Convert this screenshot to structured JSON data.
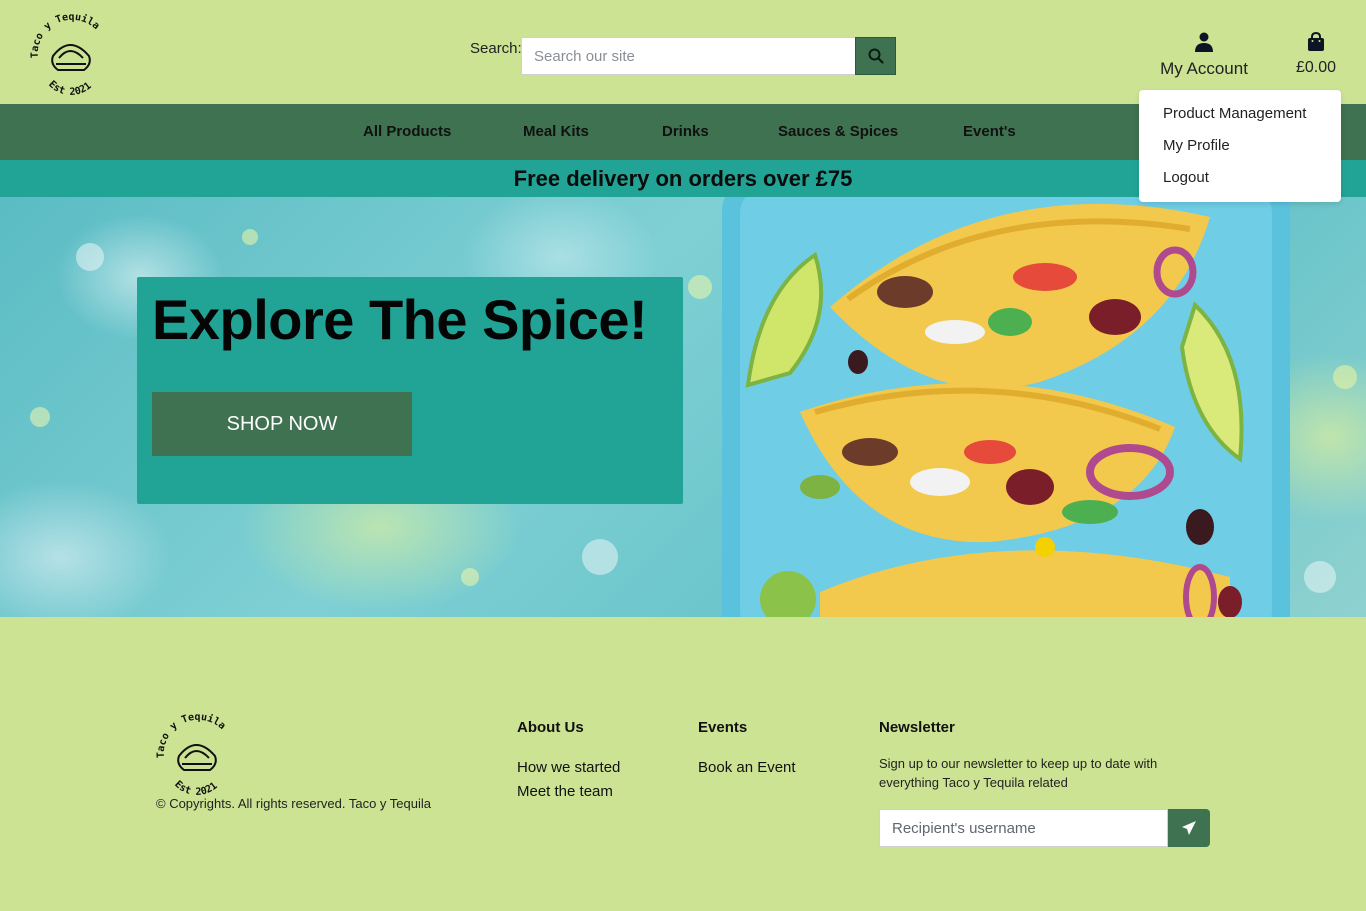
{
  "brand": {
    "logo_text_top": "Taco y Tequila",
    "logo_text_bottom": "Est 2021"
  },
  "header": {
    "search_label": "Search:",
    "search_placeholder": "Search our site",
    "search_icon": "magnifier-icon",
    "account_label": "My Account",
    "account_icon": "user-icon",
    "bag_total": "£0.00",
    "bag_icon": "shopping-bag-icon"
  },
  "account_menu": {
    "items": [
      {
        "label": "Product Management"
      },
      {
        "label": "My Profile"
      },
      {
        "label": "Logout"
      }
    ]
  },
  "nav": {
    "items": [
      {
        "label": "All Products"
      },
      {
        "label": "Meal Kits"
      },
      {
        "label": "Drinks"
      },
      {
        "label": "Sauces & Spices"
      },
      {
        "label": "Event's"
      }
    ]
  },
  "banner": {
    "text": "Free delivery on orders over £75"
  },
  "hero": {
    "title": "Explore The Spice!",
    "cta_label": "SHOP NOW"
  },
  "footer": {
    "copyright": "© Copyrights. All rights reserved. Taco y Tequila",
    "about": {
      "heading": "About Us",
      "links": [
        {
          "label": "How we started"
        },
        {
          "label": "Meet the team"
        }
      ]
    },
    "events": {
      "heading": "Events",
      "links": [
        {
          "label": "Book an Event"
        }
      ]
    },
    "newsletter": {
      "heading": "Newsletter",
      "text": "Sign up to our newsletter to keep up to date with everything Taco y Tequila related",
      "placeholder": "Recipient's username",
      "send_icon": "paper-plane-icon"
    }
  },
  "colors": {
    "page_background": "#cce394",
    "nav_green": "#3f7250",
    "banner_teal": "#21a496",
    "button_green": "#3f7250"
  }
}
